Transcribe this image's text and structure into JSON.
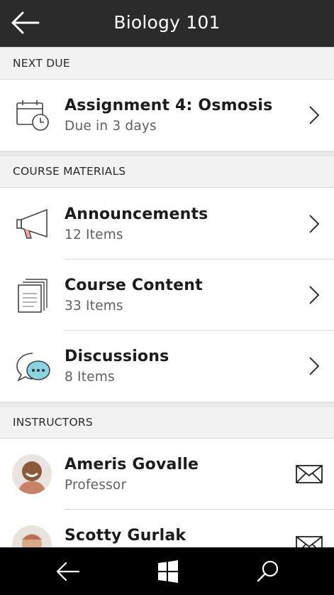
{
  "header": {
    "title": "Biology 101"
  },
  "sections": {
    "next_due": "NEXT DUE",
    "course_materials": "COURSE MATERIALS",
    "instructors": "INSTRUCTORS"
  },
  "next_due_item": {
    "title": "Assignment 4: Osmosis",
    "subtitle": "Due in 3 days"
  },
  "materials": [
    {
      "title": "Announcements",
      "subtitle": "12 Items"
    },
    {
      "title": "Course Content",
      "subtitle": "33 Items"
    },
    {
      "title": "Discussions",
      "subtitle": "8 Items"
    }
  ],
  "instructors": [
    {
      "name": "Ameris Govalle",
      "role": "Professor"
    },
    {
      "name": "Scotty Gurlak",
      "role": ""
    }
  ],
  "icons": {
    "back": "arrow-left-icon",
    "chevron": "chevron-right-icon",
    "mail": "envelope-icon",
    "windows": "windows-logo-icon",
    "search": "search-icon"
  }
}
